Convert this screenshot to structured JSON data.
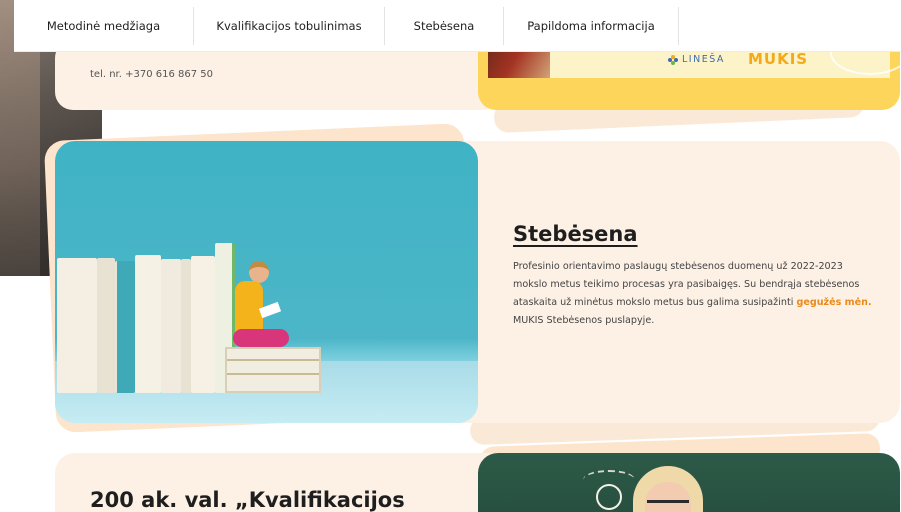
{
  "nav": {
    "items": [
      {
        "label": "Metodinė medžiaga"
      },
      {
        "label": "Kvalifikacijos tobulinimas"
      },
      {
        "label": "Stebėsena"
      },
      {
        "label": "Papildoma informacija"
      }
    ]
  },
  "contact": {
    "phone": "tel. nr. +370 616 867 50"
  },
  "partners": {
    "linesa": "LINEŠA",
    "mukis": "MUKIS"
  },
  "monitoring": {
    "title": "Stebėsena",
    "text_part1": "Profesinio orientavimo paslaugų stebėsenos duomenų už 2022-2023 mokslo metus teikimo procesas yra pasibaigęs. Su bendrąja stebėsenos ataskaita už minėtus mokslo metus bus galima susipažinti ",
    "text_highlight": "gegužės mėn.",
    "text_part2": "MUKIS Stebėsenos puslapyje.",
    "accent_color": "#ea8a1a"
  },
  "next_section": {
    "title": "200 ak. val. „Kvalifikacijos"
  },
  "icons": [
    "lightbulb-icon"
  ]
}
